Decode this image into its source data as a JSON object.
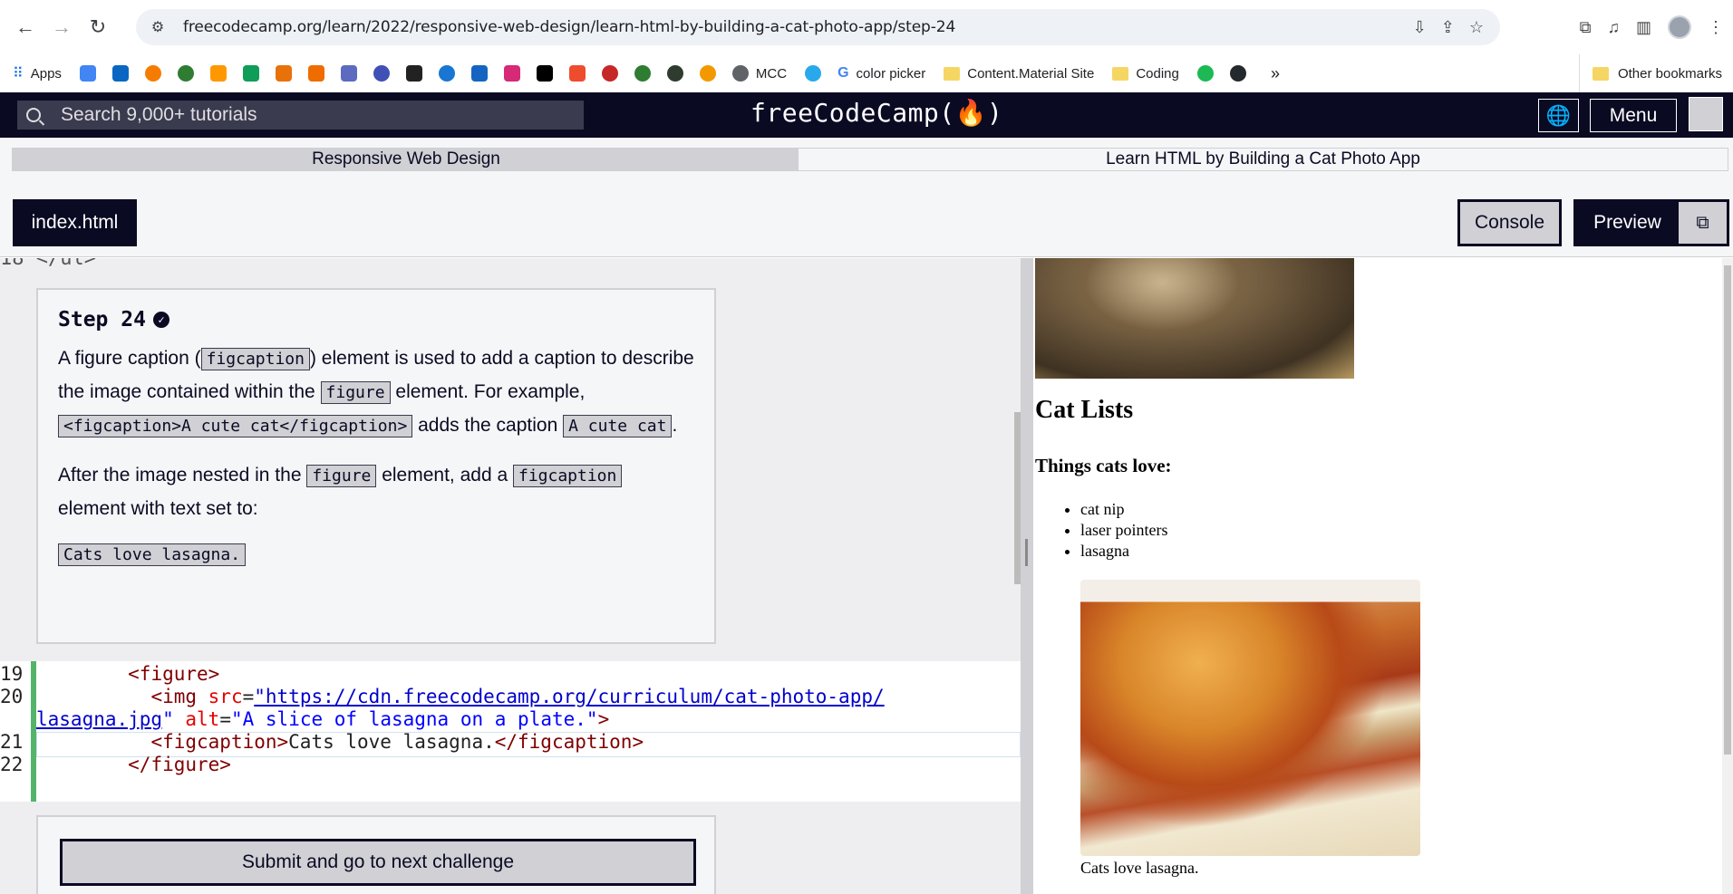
{
  "browser": {
    "url": "freecodecamp.org/learn/2022/responsive-web-design/learn-html-by-building-a-cat-photo-app/step-24",
    "bookmarks": [
      "Apps",
      "MCC",
      "color picker",
      "Content.Material Site",
      "Coding"
    ],
    "other_bookmarks": "Other bookmarks",
    "more": "»"
  },
  "nav": {
    "search_placeholder": "Search 9,000+ tutorials",
    "logo": "freeCodeCamp(🔥)",
    "menu_label": "Menu"
  },
  "breadcrumb": {
    "section": "Responsive Web Design",
    "project": "Learn HTML by Building a Cat Photo App"
  },
  "tabs": {
    "file": "index.html",
    "console": "Console",
    "preview": "Preview"
  },
  "editor": {
    "prev_line": "18      </ul>",
    "step_title": "Step 24",
    "p1_a": "A figure caption (",
    "p1_code1": "figcaption",
    "p1_b": ") element is used to add a caption to describe the image contained within the ",
    "p1_code2": "figure",
    "p1_c": " element. For example, ",
    "p1_code3": "<figcaption>A cute cat</figcaption>",
    "p1_d": " adds the caption ",
    "p1_code4": "A cute cat",
    "p1_e": ".",
    "p2_a": "After the image nested in the ",
    "p2_code1": "figure",
    "p2_b": " element, add a ",
    "p2_code2": "figcaption",
    "p2_c": " element with text set to:",
    "answer": "Cats love lasagna.",
    "line_numbers": [
      "19",
      "20",
      "21",
      "22"
    ],
    "code": {
      "l19": "<figure>",
      "l20_open": "<img ",
      "l20_src_attr": "src",
      "l20_src_val": "\"https://cdn.freecodecamp.org/curriculum/cat-photo-app/",
      "l20b_link": "lasagna.jpg",
      "l20b_q": "\"",
      "l20b_alt_attr": "alt",
      "l20b_alt_val": "\"A slice of lasagna on a plate.\"",
      "l20b_close": ">",
      "l21_open": "<figcaption>",
      "l21_text": "Cats love lasagna.",
      "l21_close": "</figcaption>",
      "l22": "</figure>"
    },
    "submit_label": "Submit and go to next challenge"
  },
  "preview": {
    "h2": "Cat Lists",
    "h3": "Things cats love:",
    "list": [
      "cat nip",
      "laser pointers",
      "lasagna"
    ],
    "caption": "Cats love lasagna."
  }
}
